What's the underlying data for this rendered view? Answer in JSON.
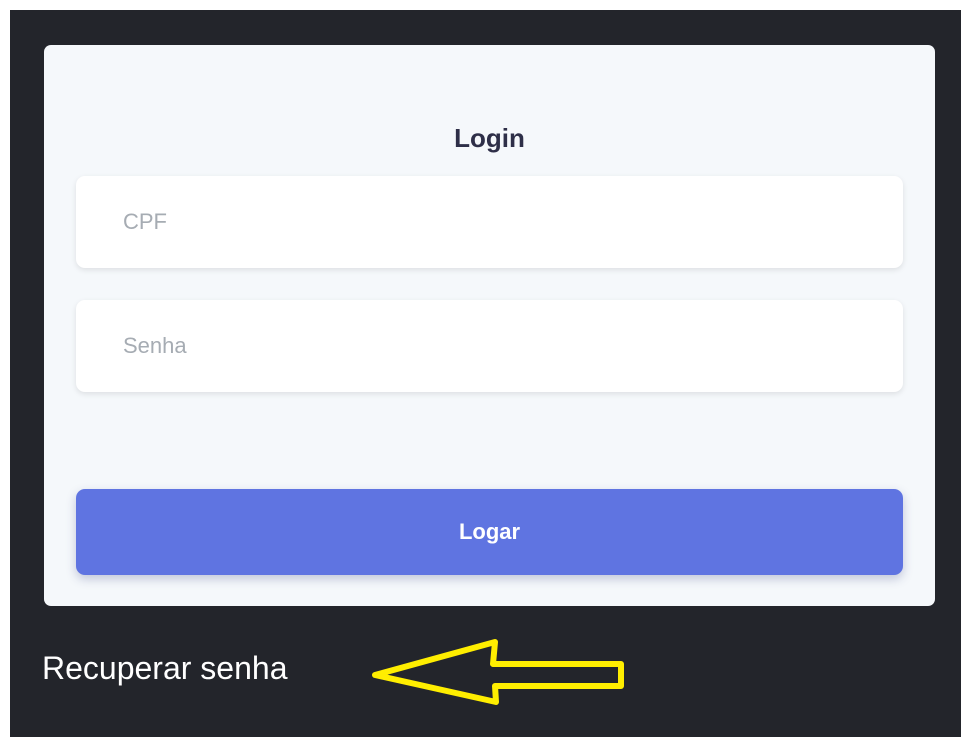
{
  "login_form": {
    "title": "Login",
    "cpf_placeholder": "CPF",
    "password_placeholder": "Senha",
    "submit_label": "Logar"
  },
  "footer": {
    "recover_password_label": "Recuperar senha"
  },
  "annotation": {
    "arrow_color": "#ffee00",
    "icon": "arrow-left-outline-icon"
  },
  "colors": {
    "background": "#23252b",
    "card": "#f5f8fb",
    "primary_button": "#5f74e1",
    "title_text": "#2e2f48"
  }
}
